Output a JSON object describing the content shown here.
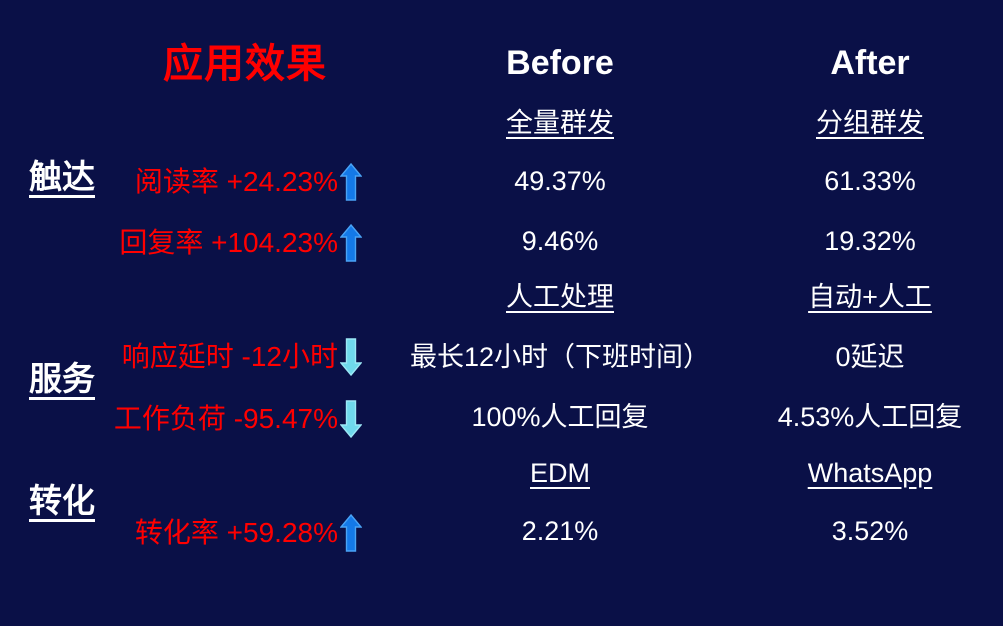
{
  "theme": {
    "background": "#0a1047",
    "title_color": "#ff0000",
    "text_color": "#ffffff",
    "metric_color": "#ff0000",
    "arrow_up_color": "#1479e8",
    "arrow_up_outline": "#4aa3f5",
    "arrow_down_color": "#6fd9ec",
    "arrow_down_outline": "#9ce8f6"
  },
  "header": {
    "title": "应用效果",
    "before_label": "Before",
    "after_label": "After"
  },
  "sections": [
    {
      "label": "触达",
      "before_sub": "全量群发",
      "after_sub": "分组群发",
      "rows": [
        {
          "metric": "阅读率 +24.23%",
          "direction": "up",
          "arrow_icon": "arrow-up-icon",
          "before": "49.37%",
          "after": "61.33%"
        },
        {
          "metric": "回复率 +104.23%",
          "direction": "up",
          "arrow_icon": "arrow-up-icon",
          "before": "9.46%",
          "after": "19.32%"
        }
      ]
    },
    {
      "label": "服务",
      "before_sub": "人工处理",
      "after_sub": "自动+人工",
      "rows": [
        {
          "metric": "响应延时 -12小时",
          "direction": "down",
          "arrow_icon": "arrow-down-icon",
          "before": "最长12小时（下班时间）",
          "after": "0延迟"
        },
        {
          "metric": "工作负荷 -95.47%",
          "direction": "down",
          "arrow_icon": "arrow-down-icon",
          "before": "100%人工回复",
          "after": "4.53%人工回复"
        }
      ]
    },
    {
      "label": "转化",
      "before_sub": "EDM",
      "after_sub": "WhatsApp",
      "rows": [
        {
          "metric": "转化率 +59.28%",
          "direction": "up",
          "arrow_icon": "arrow-up-icon",
          "before": "2.21%",
          "after": "3.52%"
        }
      ]
    }
  ]
}
